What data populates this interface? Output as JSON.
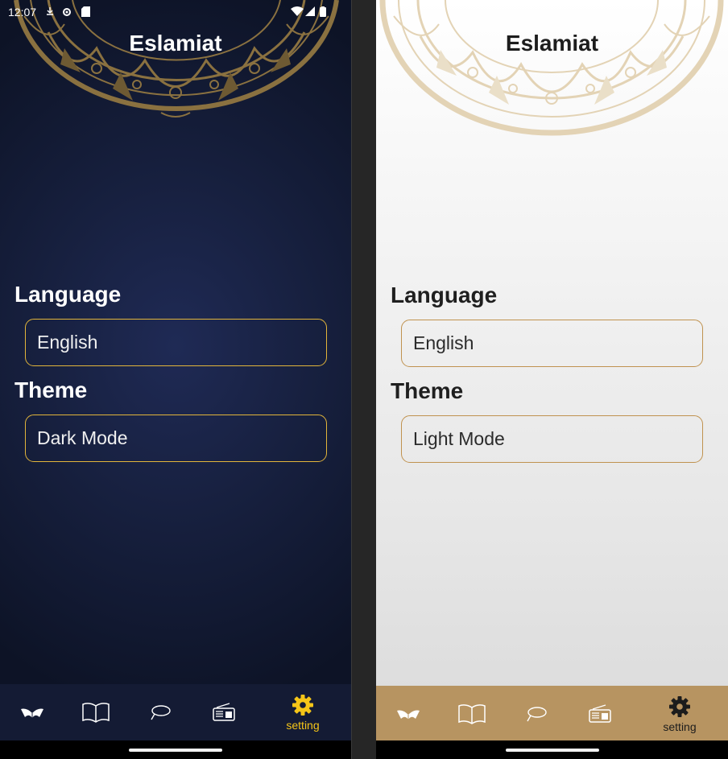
{
  "dark": {
    "status": {
      "time": "12:07"
    },
    "title": "Eslamiat",
    "language_label": "Language",
    "language_value": "English",
    "theme_label": "Theme",
    "theme_value": "Dark Mode",
    "nav": [
      {
        "icon": "quran-icon"
      },
      {
        "icon": "book-icon"
      },
      {
        "icon": "sebha-icon"
      },
      {
        "icon": "radio-icon"
      },
      {
        "icon": "gear-icon",
        "label": "setting"
      }
    ],
    "colors": {
      "accent": "#f5c518",
      "border": "#e2b53b",
      "navbar": "#141b34",
      "ornament": "#8a7140"
    }
  },
  "light": {
    "title": "Eslamiat",
    "language_label": "Language",
    "language_value": "English",
    "theme_label": "Theme",
    "theme_value": "Light Mode",
    "nav": [
      {
        "icon": "quran-icon"
      },
      {
        "icon": "book-icon"
      },
      {
        "icon": "sebha-icon"
      },
      {
        "icon": "radio-icon"
      },
      {
        "icon": "gear-icon",
        "label": "setting"
      }
    ],
    "colors": {
      "accent": "#1c1c1c",
      "border": "#c0924f",
      "navbar": "#b79461",
      "ornament": "#e3d3b5"
    }
  }
}
